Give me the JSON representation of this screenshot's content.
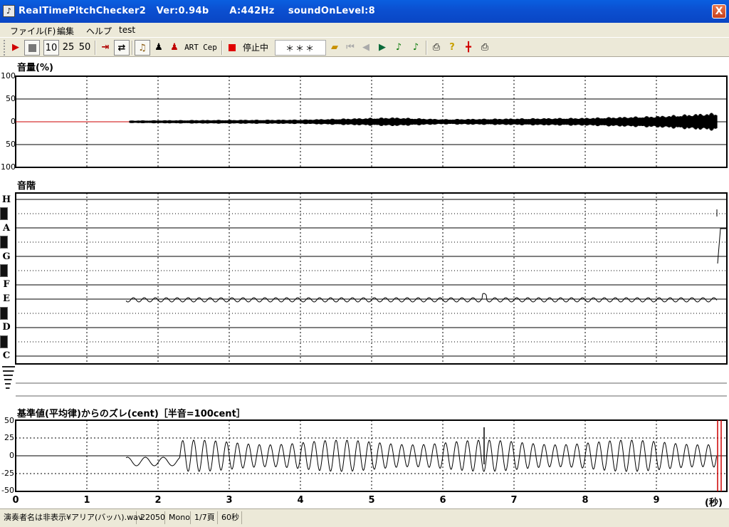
{
  "window": {
    "title": "RealTimePitchChecker2   Ver:0.94b      A:442Hz    soundOnLevel:8",
    "close_label": "X"
  },
  "menu": [
    "ファイル(F)",
    "編集",
    "ヘルプ",
    "test"
  ],
  "toolbar": {
    "zoom_buttons": [
      "10",
      "25",
      "50"
    ],
    "text_buttons": [
      "ART",
      "Cep"
    ],
    "status_label": "停止中",
    "note_display": "＊＊＊",
    "icons": [
      "play-icon",
      "stop-icon",
      "jump-end-icon",
      "loop-icon",
      "violin-icon",
      "player-icon",
      "singer-icon",
      "record-icon",
      "folder-open-icon",
      "first-page-icon",
      "prev-page-icon",
      "next-page-icon",
      "note-icon",
      "note-alt-icon",
      "print-icon",
      "help-icon",
      "marker-icon",
      "print-alt-icon"
    ]
  },
  "volume_panel": {
    "title": "音量(%)",
    "y_ticks": [
      "100",
      "50",
      "0",
      "50",
      "100"
    ]
  },
  "scale_panel": {
    "title": "音階",
    "notes": [
      "H",
      "A",
      "G",
      "F",
      "E",
      "D",
      "C"
    ]
  },
  "deviation_panel": {
    "title": "基準値(平均律)からのズレ(cent)［半音=100cent］",
    "y_ticks": [
      "50",
      "25",
      "0",
      "-25",
      "-50"
    ]
  },
  "x_axis": {
    "ticks": [
      "0",
      "1",
      "2",
      "3",
      "4",
      "5",
      "6",
      "7",
      "8",
      "9"
    ],
    "unit": "(秒)"
  },
  "statusbar": {
    "file": "演奏者名は非表示¥アリア(バッハ).wav",
    "sample_rate": "22050",
    "channels": "Mono",
    "page": "1/7頁",
    "duration": "60秒"
  },
  "colors": {
    "titlebar": "#0b4fd0",
    "chrome": "#ece9d8",
    "silence_line": "#cc0000",
    "marker": "#cc0000"
  },
  "chart_data": [
    {
      "type": "area",
      "title": "音量(%)",
      "x_range_seconds": [
        0,
        10
      ],
      "y_range": [
        -100,
        100
      ],
      "signal_start_seconds": 1.6,
      "amplitude_envelope_percent": [
        [
          1.6,
          3
        ],
        [
          2.5,
          4
        ],
        [
          4,
          5
        ],
        [
          5.3,
          10
        ],
        [
          6,
          6
        ],
        [
          7.2,
          8
        ],
        [
          8,
          9
        ],
        [
          9,
          13
        ],
        [
          9.8,
          20
        ]
      ]
    },
    {
      "type": "line",
      "title": "音階",
      "note_labels": [
        "H",
        "A",
        "G",
        "F",
        "E",
        "D",
        "C"
      ],
      "x_range_seconds": [
        0,
        10
      ],
      "dominant_note": "E",
      "segment_start_seconds": 1.55,
      "segment_end_seconds": 9.85
    },
    {
      "type": "line",
      "title": "基準値(平均律)からのズレ(cent)［半音=100cent］",
      "x_range_seconds": [
        0,
        10
      ],
      "ylim": [
        -50,
        50
      ],
      "y_ticks": [
        50,
        25,
        0,
        -25,
        -50
      ],
      "segment_start_seconds": 1.55,
      "oscillation_amplitude_cents": 22,
      "cycles_per_second": 6.5,
      "spike_time_seconds": 6.58,
      "marker_time_seconds": 9.88
    }
  ]
}
